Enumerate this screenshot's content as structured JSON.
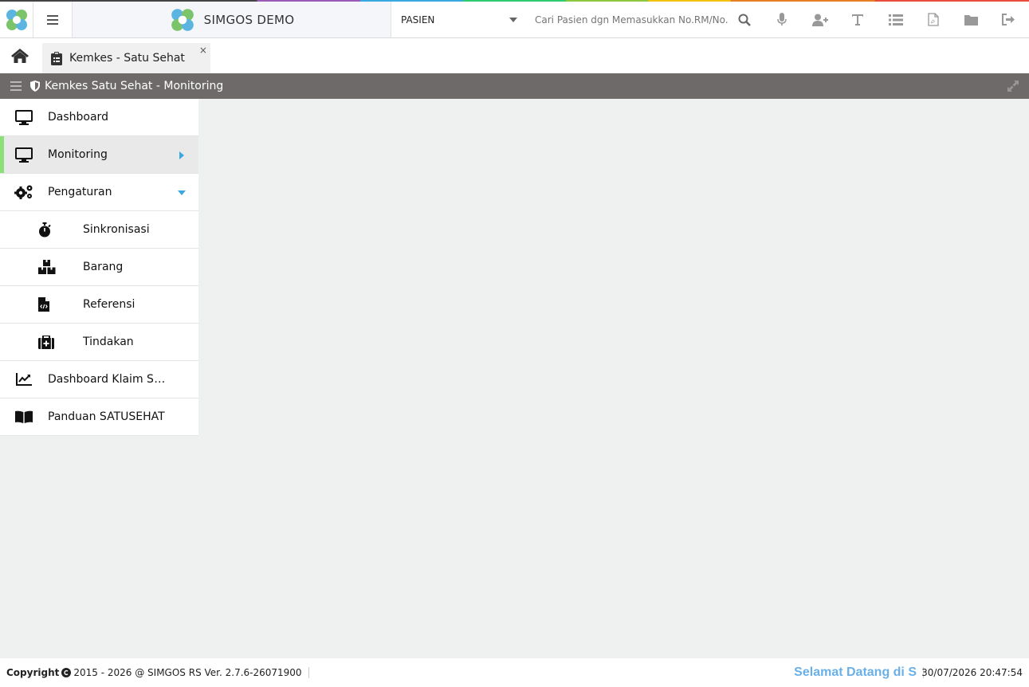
{
  "header": {
    "brand": "SIMGOS DEMO",
    "search_category": "PASIEN",
    "search_placeholder": "Cari Pasien dgn Memasukkan No.RM/No.KTP",
    "icons": [
      "search-icon",
      "microphone-icon",
      "add-user-icon",
      "text-icon",
      "list-icon",
      "pdf-icon",
      "folder-icon",
      "sign-out-icon"
    ]
  },
  "tabs": [
    {
      "label": "Kemkes - Satu Sehat",
      "close": "×"
    }
  ],
  "titlebar": {
    "title": "Kemkes Satu Sehat - Monitoring"
  },
  "sidebar": {
    "items": [
      {
        "label": "Dashboard",
        "icon": "monitor-icon"
      },
      {
        "label": "Monitoring",
        "icon": "monitor-icon",
        "active": true
      },
      {
        "label": "Pengaturan",
        "icon": "cogs-icon",
        "expanded": true
      },
      {
        "label": "Sinkronisasi",
        "icon": "stopwatch-icon",
        "sub": true
      },
      {
        "label": "Barang",
        "icon": "boxes-icon",
        "sub": true
      },
      {
        "label": "Referensi",
        "icon": "file-code-icon",
        "sub": true
      },
      {
        "label": "Tindakan",
        "icon": "medkit-icon",
        "sub": true
      },
      {
        "label": "Dashboard Klaim SATUSEHAT",
        "icon": "chart-line-icon"
      },
      {
        "label": "Panduan SATUSEHAT",
        "icon": "book-icon"
      }
    ]
  },
  "footer": {
    "copyright_label": "Copyright",
    "copyright_text": "2015 - 2026 @ SIMGOS RS Ver. 2.7.6-26071900",
    "welcome": "Selamat Datang di S",
    "datetime": "30/07/2026 20:47:54"
  },
  "colors": {
    "accent_green": "#8be07a",
    "titlebar_bg": "#6e6a69",
    "welcome_blue": "#6ab0e8",
    "caret_blue": "#3aa8e0"
  }
}
